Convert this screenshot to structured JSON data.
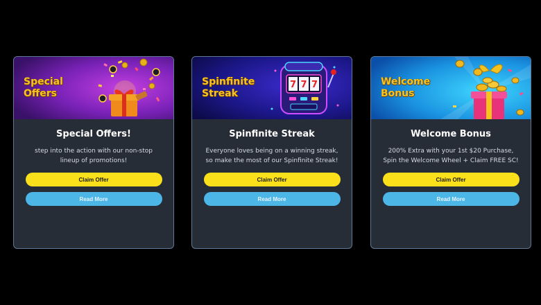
{
  "colors": {
    "page_bg": "#000000",
    "card_bg": "#272d37",
    "card_border": "#5d7a98",
    "banner_title": "#f8c31e",
    "claim_button": "#f9e01b",
    "read_more_button": "#4cb6e6"
  },
  "cards": [
    {
      "banner_title": "Special Offers",
      "banner_art": "gift-box-with-confetti-and-chips",
      "title": "Special Offers!",
      "description": "step into the action with our non-stop lineup of promotions!",
      "claim_label": "Claim Offer",
      "read_more_label": "Read More"
    },
    {
      "banner_title": "Spinfinite Streak",
      "banner_art": "slot-machine-777",
      "title": "Spinfinite Streak",
      "description": "Everyone loves being on a winning streak, so make the most of our Spinfinite Streak!",
      "claim_label": "Claim Offer",
      "read_more_label": "Read More"
    },
    {
      "banner_title": "Welcome Bonus",
      "banner_art": "gift-box-with-gold-coins",
      "title": "Welcome Bonus",
      "description": "200% Extra with your 1st $20 Purchase, Spin the Welcome Wheel + Claim FREE SC!",
      "claim_label": "Claim Offer",
      "read_more_label": "Read More"
    }
  ]
}
